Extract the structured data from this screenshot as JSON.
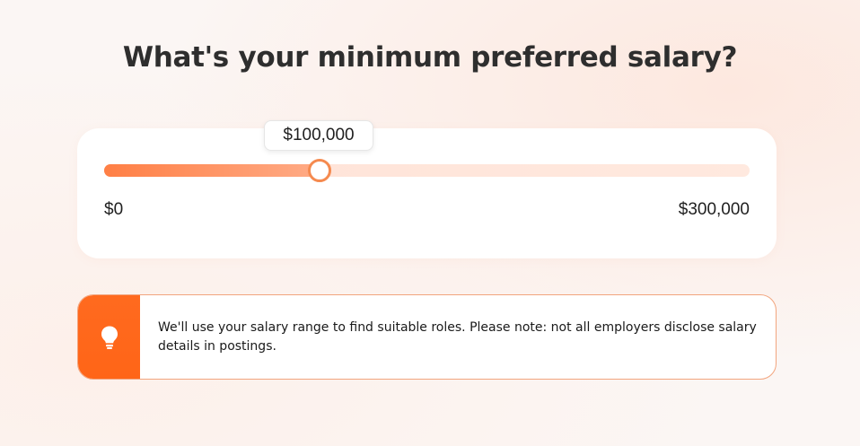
{
  "heading": {
    "title": "What's your minimum preferred salary?"
  },
  "salary_slider": {
    "current_label": "$100,000",
    "current_value": 100000,
    "min_label": "$0",
    "max_label": "$300,000",
    "min_value": 0,
    "max_value": 300000
  },
  "info": {
    "icon": "lightbulb-icon",
    "text": "We'll use your salary range to find suitable roles. Please note: not all employers disclose salary details in postings."
  },
  "colors": {
    "accent": "#ff6a1f",
    "track_fill_start": "#ff7f45",
    "track_bg": "#ffe5da",
    "thumb_border": "#f58a4f",
    "info_border": "#f2a57e"
  }
}
